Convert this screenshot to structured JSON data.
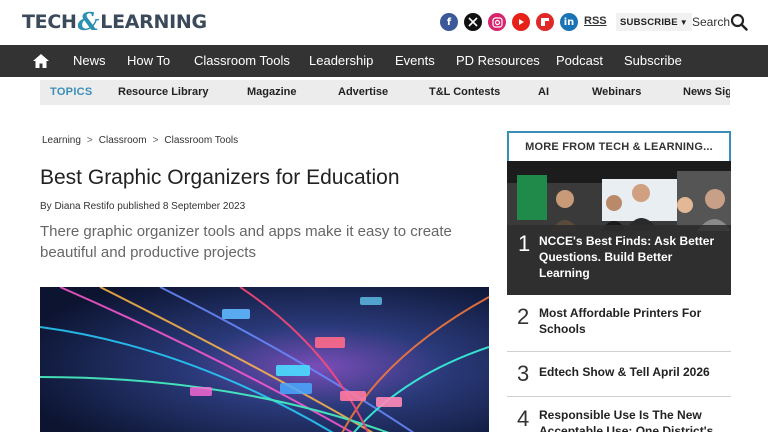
{
  "header": {
    "logo_left": "TECH",
    "logo_amp": "&",
    "logo_right": "LEARNING",
    "social_icons": [
      "facebook-icon",
      "x-icon",
      "instagram-icon",
      "youtube-icon",
      "flipboard-icon",
      "linkedin-icon"
    ],
    "rss_label": "RSS",
    "subscribe_label": "SUBSCRIBE",
    "search_label": "Search"
  },
  "nav": {
    "home_icon": "home-icon",
    "items": [
      "News",
      "How To",
      "Classroom Tools",
      "Leadership",
      "Events",
      "PD Resources",
      "Podcast",
      "Subscribe"
    ]
  },
  "topics": {
    "lead": "TOPICS",
    "items": [
      "Resource Library",
      "Magazine",
      "Advertise",
      "T&L Contests",
      "AI",
      "Webinars",
      "News Sig"
    ]
  },
  "breadcrumb": [
    "Learning",
    "Classroom",
    "Classroom Tools"
  ],
  "breadcrumb_sep": ">",
  "article": {
    "title": "Best Graphic Organizers for Education",
    "byline": "By Diana Restifo published 8 September 2023",
    "dek": "There graphic organizer tools and apps make it easy to create beautiful and productive projects"
  },
  "sidebar": {
    "heading": "MORE FROM TECH & LEARNING...",
    "items": [
      {
        "rank": "1",
        "title": "NCCE's Best Finds: Ask Better Questions. Build Better Learning"
      },
      {
        "rank": "2",
        "title": "Most Affordable Printers For Schools"
      },
      {
        "rank": "3",
        "title": "Edtech Show & Tell April 2026"
      },
      {
        "rank": "4",
        "title": "Responsible Use Is The New Acceptable Use: One District's"
      }
    ]
  },
  "colors": {
    "accent": "#3a8fb7",
    "nav_bg": "#333333",
    "topics_bg": "#ececec"
  }
}
